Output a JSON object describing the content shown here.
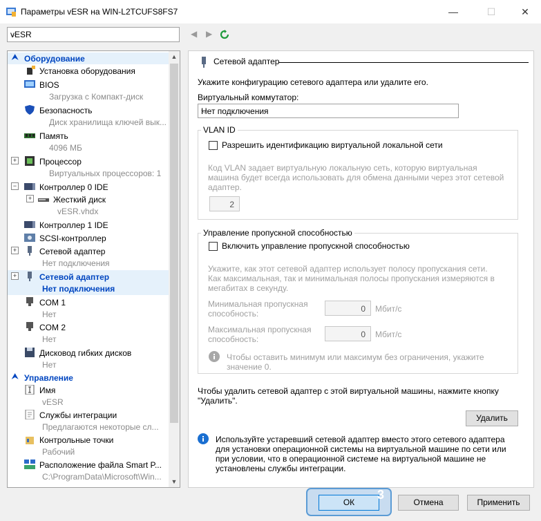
{
  "window": {
    "title": "Параметры vESR на WIN-L2TCUFS8FS7",
    "minimize": "—",
    "maximize": "☐",
    "close": "✕"
  },
  "toolbar": {
    "vm_name": "vESR"
  },
  "tree": {
    "hardware_header": "Оборудование",
    "items": [
      {
        "label": "Установка оборудования",
        "sub": ""
      },
      {
        "label": "BIOS",
        "sub": "Загрузка с Компакт-диск"
      },
      {
        "label": "Безопасность",
        "sub": "Диск хранилища ключей вык..."
      },
      {
        "label": "Память",
        "sub": "4096 МБ"
      },
      {
        "label": "Процессор",
        "sub": "Виртуальных процессоров: 1"
      },
      {
        "label": "Контроллер 0 IDE",
        "sub": ""
      },
      {
        "label": "Жесткий диск",
        "sub": "vESR.vhdx"
      },
      {
        "label": "Контроллер 1 IDE",
        "sub": ""
      },
      {
        "label": "SCSI-контроллер",
        "sub": ""
      },
      {
        "label": "Сетевой адаптер",
        "sub": "Нет подключения"
      },
      {
        "label": "Сетевой адаптер",
        "sub": "Нет подключения"
      },
      {
        "label": "COM 1",
        "sub": "Нет"
      },
      {
        "label": "COM 2",
        "sub": "Нет"
      },
      {
        "label": "Дисковод гибких дисков",
        "sub": "Нет"
      }
    ],
    "management_header": "Управление",
    "mgmt_items": [
      {
        "label": "Имя",
        "sub": "vESR"
      },
      {
        "label": "Службы интеграции",
        "sub": "Предлагаются некоторые сл..."
      },
      {
        "label": "Контрольные точки",
        "sub": "Рабочий"
      },
      {
        "label": "Расположение файла Smart P...",
        "sub": "C:\\ProgramData\\Microsoft\\Win..."
      }
    ]
  },
  "panel": {
    "title": "Сетевой адаптер",
    "intro": "Укажите конфигурацию сетевого адаптера или удалите его.",
    "switch_label": "Виртуальный коммутатор:",
    "switch_value": "Нет подключения",
    "vlan": {
      "group_label": "VLAN ID",
      "checkbox_label": "Разрешить идентификацию виртуальной локальной сети",
      "desc1": "Код VLAN задает виртуальную локальную сеть, которую виртуальная",
      "desc2": "машина будет всегда использовать для обмена данными через этот сетевой",
      "desc3": "адаптер.",
      "value": "2"
    },
    "bandwidth": {
      "group_label": "Управление пропускной способностью",
      "checkbox_label": "Включить управление пропускной способностью",
      "desc1": "Укажите, как этот сетевой адаптер использует полосу пропускания сети.",
      "desc2": "Как максимальная, так и минимальная полосы пропускания измеряются в",
      "desc3": "мегабитах в секунду.",
      "min_label1": "Минимальная пропускная",
      "min_label2": "способность:",
      "min_value": "0",
      "max_label1": "Максимальная пропускная",
      "max_label2": "способность:",
      "max_value": "0",
      "unit": "Мбит/с",
      "info1": "Чтобы оставить минимум или максимум без ограничения, укажите",
      "info2": "значение 0."
    },
    "remove_text1": "Чтобы удалить сетевой адаптер с этой виртуальной машины, нажмите кнопку",
    "remove_text2": "\"Удалить\".",
    "remove_button": "Удалить",
    "legacy_info1": "Используйте устаревший сетевой адаптер вместо этого сетевого адаптера",
    "legacy_info2": "для установки операционной системы на виртуальной машине по сети или",
    "legacy_info3": "при условии, что в операционной системе на виртуальной машине не",
    "legacy_info4": "установлены службы интеграции."
  },
  "footer": {
    "ok": "ОК",
    "cancel": "Отмена",
    "apply": "Применить",
    "step_badge": "3"
  }
}
